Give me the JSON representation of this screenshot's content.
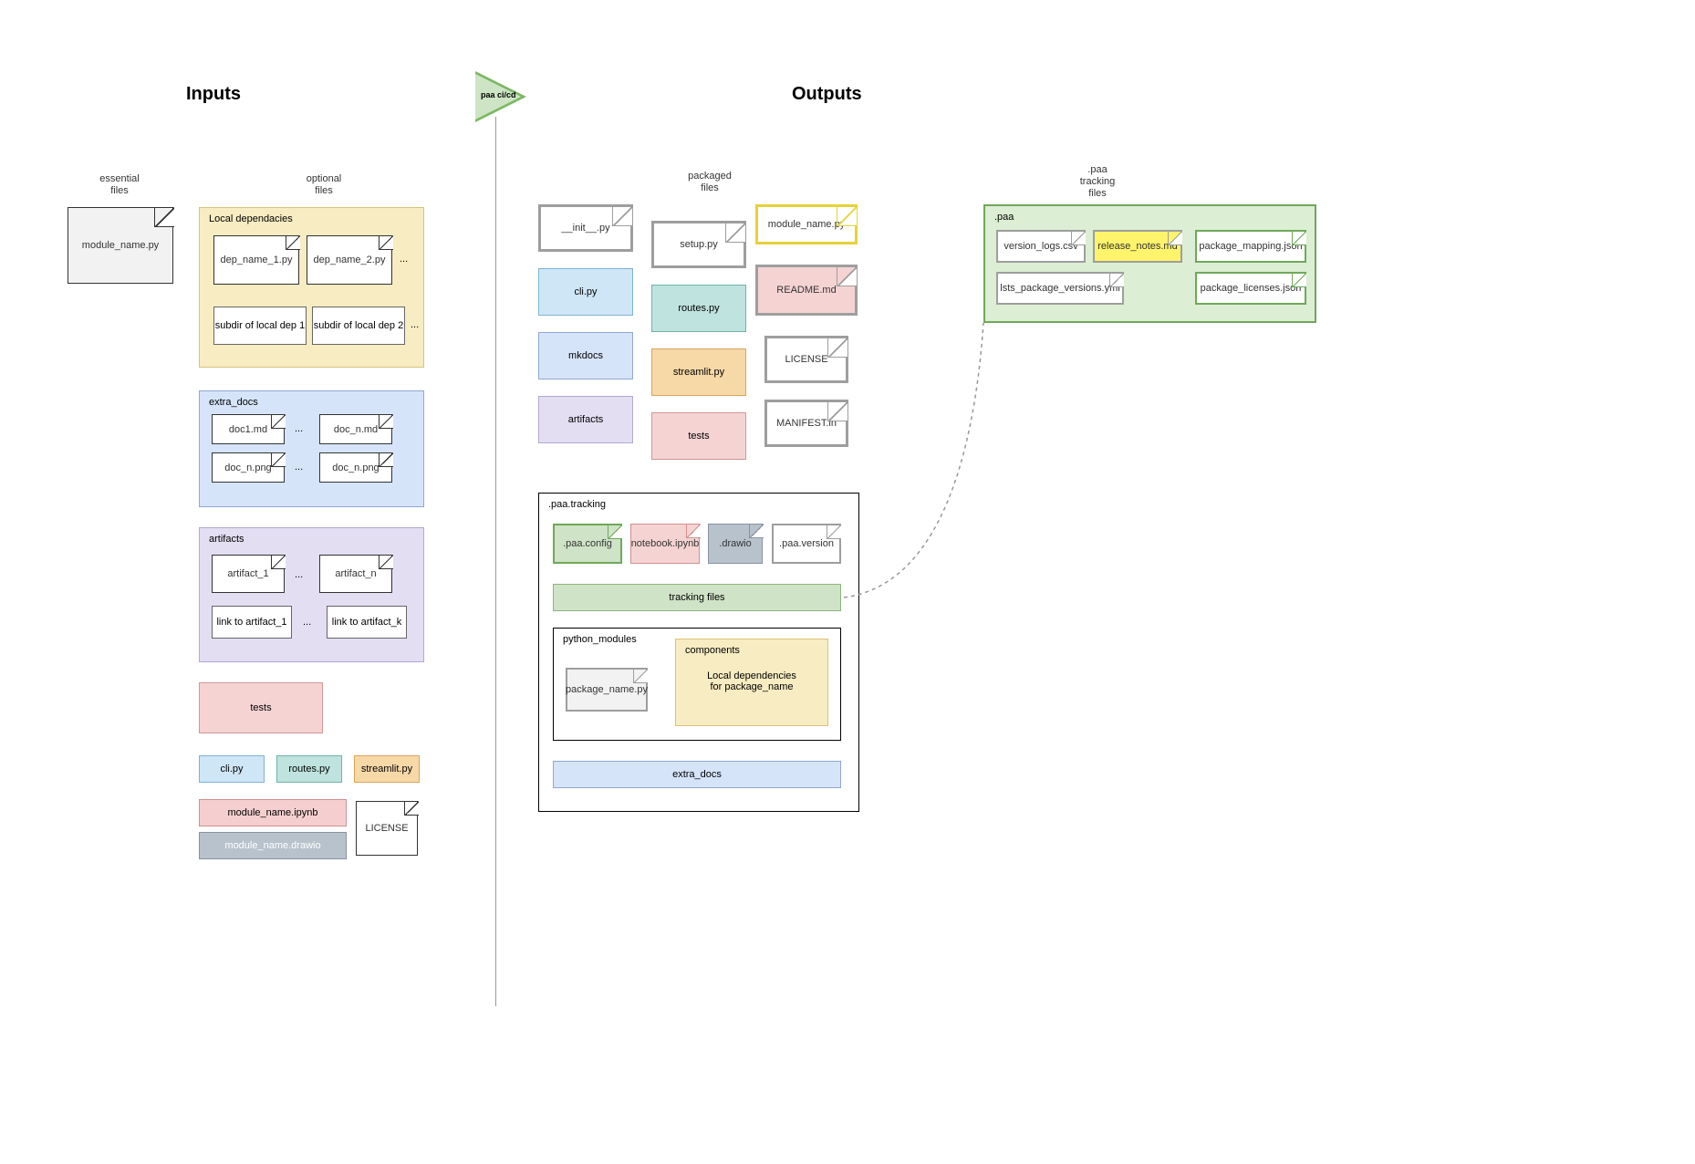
{
  "headings": {
    "inputs": "Inputs",
    "outputs": "Outputs"
  },
  "marker": {
    "label": "paa ci/cd"
  },
  "col_labels": {
    "essential": "essential\nfiles",
    "optional": "optional\nfiles",
    "packaged": "packaged\nfiles",
    "paa_tracking": ".paa\ntracking\nfiles"
  },
  "inputs": {
    "essential_file": "module_name.py",
    "local_deps": {
      "title": "Local dependacies",
      "files": [
        "dep_name_1.py",
        "dep_name_2.py"
      ],
      "subdirs": [
        "subdir of local dep 1",
        "subdir of local dep 2"
      ],
      "ellipsis": "..."
    },
    "extra_docs": {
      "title": "extra_docs",
      "row1": [
        "doc1.md",
        "doc_n.md"
      ],
      "row2": [
        "doc_n.png",
        "doc_n.png"
      ],
      "ellipsis": "..."
    },
    "artifacts": {
      "title": "artifacts",
      "row1": [
        "artifact_1",
        "artifact_n"
      ],
      "row2": [
        "link to artifact_1",
        "link to artifact_k"
      ],
      "ellipsis": "..."
    },
    "tests": "tests",
    "small_boxes": {
      "cli": "cli.py",
      "routes": "routes.py",
      "streamlit": "streamlit.py"
    },
    "ipynb": "module_name.ipynb",
    "drawio": "module_name.drawio",
    "license": "LICENSE"
  },
  "outputs": {
    "col1": {
      "init": "__init__.py",
      "cli": "cli.py",
      "mkdocs": "mkdocs",
      "artifacts": "artifacts"
    },
    "col2": {
      "setup": "setup.py",
      "routes": "routes.py",
      "streamlit": "streamlit.py",
      "tests": "tests"
    },
    "col3": {
      "module": "module_name.py",
      "readme": "README.md",
      "license": "LICENSE",
      "manifest": "MANIFEST.in"
    },
    "paa_tracking_box": {
      "title": ".paa.tracking",
      "files": {
        "config": ".paa.config",
        "notebook": "notebook.ipynb",
        "drawio": ".drawio",
        "version": ".paa.version"
      },
      "tracking_bar": "tracking files",
      "python_modules": {
        "title": "python_modules",
        "package_file": "package_name.py",
        "components": {
          "title": "components",
          "desc": "Local dependencies\nfor package_name"
        }
      },
      "extra_docs_bar": "extra_docs"
    },
    "paa_box": {
      "title": ".paa",
      "files": {
        "version_logs": "version_logs.csv",
        "release_notes": "release_notes.md",
        "lsts": "lsts_package_versions.yml",
        "mapping": "package_mapping.json",
        "licenses": "package_licenses.json"
      }
    }
  }
}
